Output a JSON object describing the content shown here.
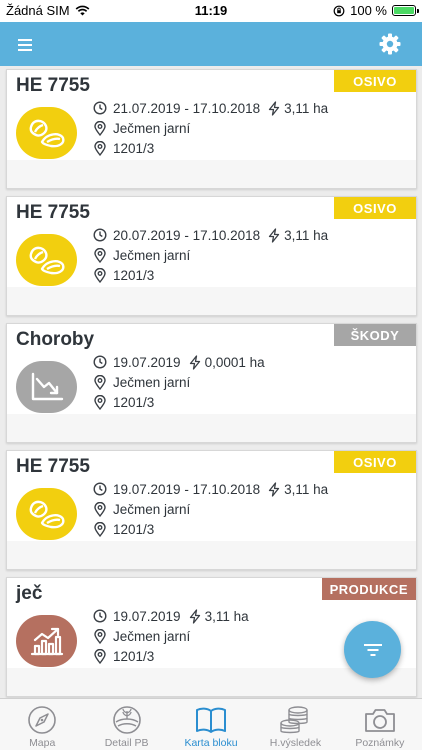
{
  "status_bar": {
    "carrier": "Žádná SIM",
    "time": "11:19",
    "battery": "100 %"
  },
  "colors": {
    "header": "#5bb1dc",
    "osivo": "#f2cf0f",
    "skody": "#a6a6a6",
    "produkce": "#b57060",
    "tab_active": "#2b8ed0"
  },
  "cards": [
    {
      "title": "HE 7755",
      "badge": "OSIVO",
      "date": "21.07.2019 - 17.10.2018",
      "area": "3,11 ha",
      "crop": "Ječmen jarní",
      "block": "1201/3",
      "icon": "seed-icon"
    },
    {
      "title": "HE 7755",
      "badge": "OSIVO",
      "date": "20.07.2019 - 17.10.2018",
      "area": "3,11 ha",
      "crop": "Ječmen jarní",
      "block": "1201/3",
      "icon": "seed-icon"
    },
    {
      "title": "Choroby",
      "badge": "ŠKODY",
      "date": "19.07.2019",
      "area": "0,0001 ha",
      "crop": "Ječmen jarní",
      "block": "1201/3",
      "icon": "chart-down-icon"
    },
    {
      "title": "HE 7755",
      "badge": "OSIVO",
      "date": "19.07.2019 - 17.10.2018",
      "area": "3,11 ha",
      "crop": "Ječmen jarní",
      "block": "1201/3",
      "icon": "seed-icon"
    },
    {
      "title": "ječ",
      "badge": "PRODUKCE",
      "date": "19.07.2019",
      "area": "3,11 ha",
      "crop": "Ječmen jarní",
      "block": "1201/3",
      "icon": "chart-up-icon"
    }
  ],
  "tabs": [
    {
      "label": "Mapa",
      "icon": "compass-icon"
    },
    {
      "label": "Detail PB",
      "icon": "field-icon"
    },
    {
      "label": "Karta bloku",
      "icon": "book-icon"
    },
    {
      "label": "H.výsledek",
      "icon": "coins-icon"
    },
    {
      "label": "Poznámky",
      "icon": "camera-icon"
    }
  ],
  "active_tab": "Karta bloku"
}
